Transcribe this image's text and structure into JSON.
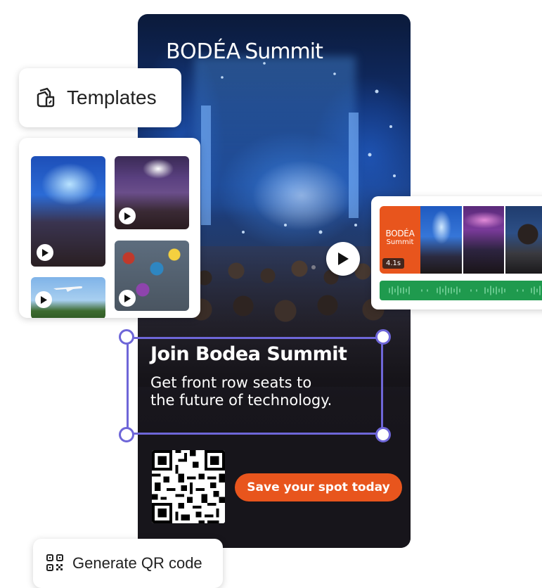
{
  "poster": {
    "brand_main": "BODÉA",
    "brand_sub": "Summit",
    "headline": "Join Bodea Summit",
    "subline_1": "Get front row seats to",
    "subline_2": "the future of technology.",
    "cta_label": "Save your spot today"
  },
  "templates_chip": {
    "label": "Templates"
  },
  "timeline": {
    "brand_clip_line1": "BODÉA",
    "brand_clip_line2": "Summit",
    "clip_duration": "4.1s"
  },
  "qr_chip": {
    "label": "Generate QR code"
  },
  "colors": {
    "accent_orange": "#e8551d",
    "selection_purple": "#6e66d8",
    "audio_green": "#1f9a4e"
  }
}
